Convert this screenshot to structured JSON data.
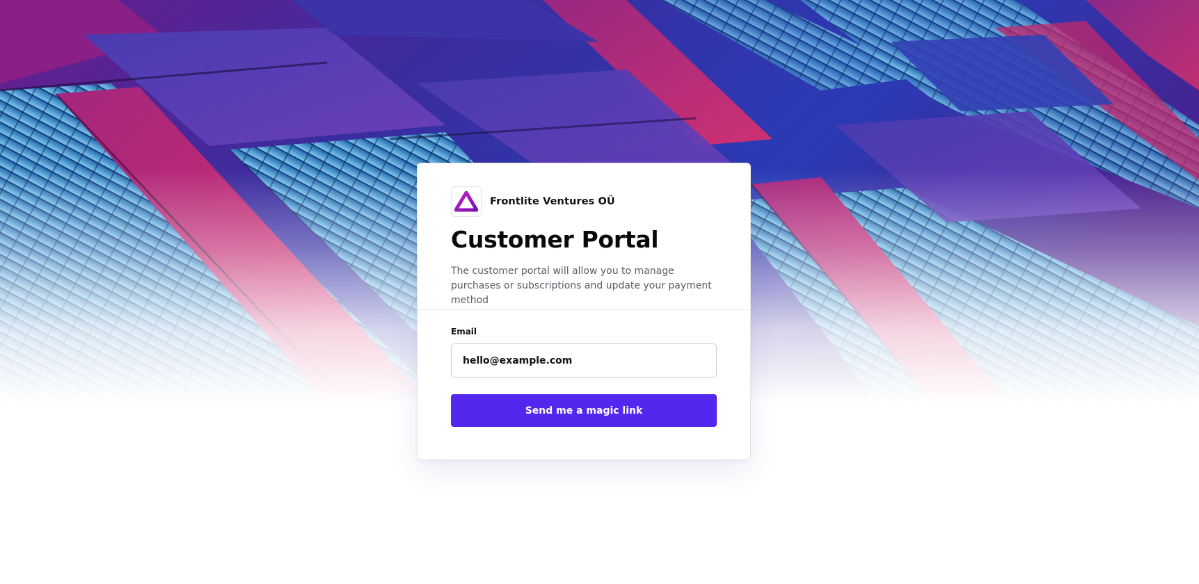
{
  "brand": {
    "name": "Frontlite Ventures OÜ",
    "logo_icon": "triangle-logo-icon",
    "accent": "#5426ee"
  },
  "page": {
    "title": "Customer Portal",
    "subtitle": "The customer portal will allow you to manage purchases or subscriptions and update your payment method"
  },
  "form": {
    "email_label": "Email",
    "email_value": "hello@example.com",
    "submit_label": "Send me a magic link"
  },
  "hero": {
    "image_icon": "building-facade-image",
    "colors": [
      "#2a3bb5",
      "#7b2aa0",
      "#d2245f",
      "#4aa8e6"
    ]
  }
}
